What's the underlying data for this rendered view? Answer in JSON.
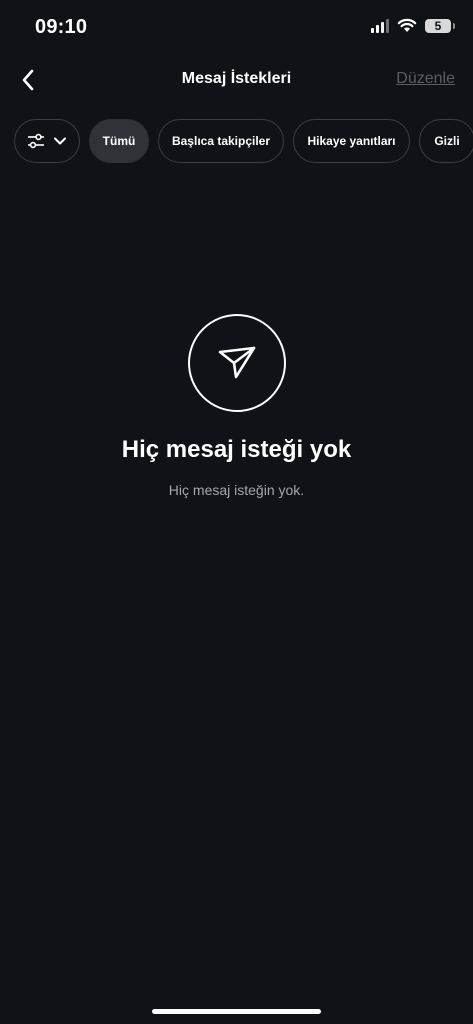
{
  "status_bar": {
    "time": "09:10",
    "battery": "5"
  },
  "header": {
    "title": "Mesaj İstekleri",
    "edit_label": "Düzenle",
    "back_icon": "chevron-left-icon"
  },
  "filters": {
    "dropdown_icons": [
      "sliders-icon",
      "chevron-down-icon"
    ],
    "chips": [
      {
        "label": "Tümü",
        "active": true
      },
      {
        "label": "Başlıca takipçiler",
        "active": false
      },
      {
        "label": "Hikaye yanıtları",
        "active": false
      },
      {
        "label": "Gizli",
        "active": false
      }
    ]
  },
  "empty_state": {
    "icon": "paper-plane-icon",
    "title": "Hiç mesaj isteği yok",
    "subtitle": "Hiç mesaj isteğin yok."
  },
  "colors": {
    "background": "#0f1216",
    "chip_border": "#3b3f45",
    "chip_active": "#2f3338",
    "muted_text": "#a4a7ac",
    "disabled_link": "#5a5d63"
  }
}
